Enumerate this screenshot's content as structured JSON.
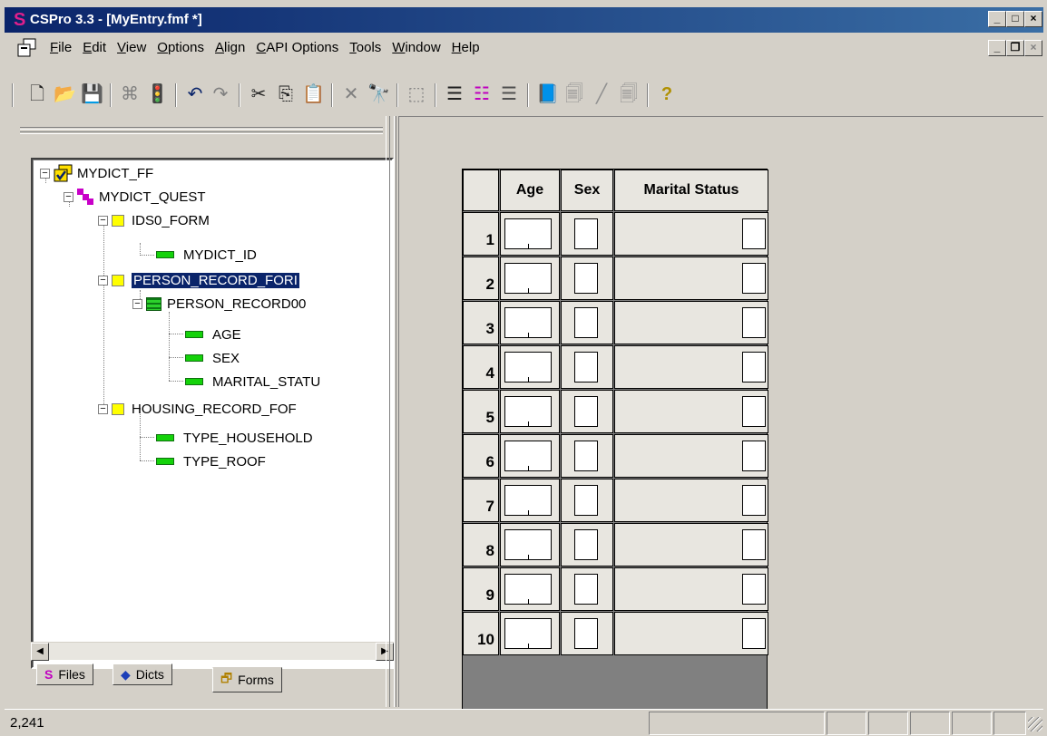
{
  "window": {
    "title": "CSPro 3.3 - [MyEntry.fmf *]",
    "app_icon_glyph": "S",
    "controls": [
      "_",
      "□",
      "×"
    ],
    "doc_controls": [
      "_",
      "❐",
      "×"
    ]
  },
  "menu": {
    "items": [
      "File",
      "Edit",
      "View",
      "Options",
      "Align",
      "CAPI Options",
      "Tools",
      "Window",
      "Help"
    ]
  },
  "toolbar": {
    "buttons": [
      {
        "name": "new-icon",
        "glyph": "🗋"
      },
      {
        "name": "open-icon",
        "glyph": "📂"
      },
      {
        "name": "save-icon",
        "glyph": "💾"
      },
      {
        "name": "generate-icon",
        "glyph": "⌘"
      },
      {
        "name": "run-icon",
        "glyph": "🚦"
      },
      {
        "name": "undo-icon",
        "glyph": "↶"
      },
      {
        "name": "redo-icon",
        "glyph": "↷"
      },
      {
        "name": "cut-icon",
        "glyph": "✂"
      },
      {
        "name": "copy-icon",
        "glyph": "⎘"
      },
      {
        "name": "paste-icon",
        "glyph": "📋"
      },
      {
        "name": "delete-icon",
        "glyph": "✕"
      },
      {
        "name": "find-icon",
        "glyph": "🔭"
      },
      {
        "name": "select-icon",
        "glyph": "⬚"
      },
      {
        "name": "align-left-icon",
        "glyph": "☰"
      },
      {
        "name": "align-color-icon",
        "glyph": "☷"
      },
      {
        "name": "list-icon",
        "glyph": "☰"
      },
      {
        "name": "dictionary-icon",
        "glyph": "📘"
      },
      {
        "name": "forms-icon",
        "glyph": "🗐"
      },
      {
        "name": "edit-icon",
        "glyph": "╱"
      },
      {
        "name": "forms-disabled-icon",
        "glyph": "🗐"
      },
      {
        "name": "help-icon",
        "glyph": "?"
      }
    ]
  },
  "tree": {
    "nodes": [
      {
        "label": "MYDICT_FF",
        "level": 0,
        "icon": "form-file-icon",
        "expander": "−"
      },
      {
        "label": "MYDICT_QUEST",
        "level": 1,
        "icon": "questionnaire-icon",
        "expander": "−"
      },
      {
        "label": "IDS0_FORM",
        "level": 2,
        "icon": "form-icon",
        "expander": "−"
      },
      {
        "label": "MYDICT_ID",
        "level": 3,
        "icon": "item-icon"
      },
      {
        "label": "PERSON_RECORD_FORI",
        "level": 2,
        "icon": "form-icon",
        "expander": "−",
        "selected": true
      },
      {
        "label": "PERSON_RECORD00",
        "level": 3,
        "icon": "roster-icon",
        "expander": "−"
      },
      {
        "label": "AGE",
        "level": 4,
        "icon": "item-icon"
      },
      {
        "label": "SEX",
        "level": 4,
        "icon": "item-icon"
      },
      {
        "label": "MARITAL_STATU",
        "level": 4,
        "icon": "item-icon"
      },
      {
        "label": "HOUSING_RECORD_FOF",
        "level": 2,
        "icon": "form-icon",
        "expander": "−"
      },
      {
        "label": "TYPE_HOUSEHOLD",
        "level": 3,
        "icon": "item-icon"
      },
      {
        "label": "TYPE_ROOF",
        "level": 3,
        "icon": "item-icon"
      }
    ]
  },
  "tabs": [
    {
      "label": "Files",
      "active": false
    },
    {
      "label": "Dicts",
      "active": false
    },
    {
      "label": "Forms",
      "active": true
    }
  ],
  "roster": {
    "columns": [
      "Age",
      "Sex",
      "Marital Status"
    ],
    "rows": [
      "1",
      "2",
      "3",
      "4",
      "5",
      "6",
      "7",
      "8",
      "9",
      "10"
    ]
  },
  "status": {
    "position": "2,241"
  }
}
